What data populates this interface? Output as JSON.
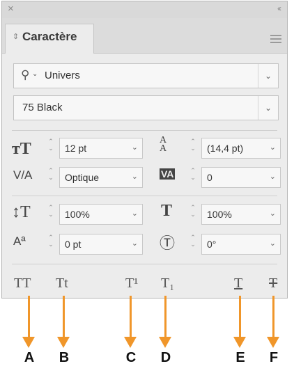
{
  "panel": {
    "close_glyph": "×",
    "collapse_glyph": "‹‹",
    "tab_arrows": "⇕",
    "tab_label": "Caractère"
  },
  "font": {
    "family": "Univers",
    "style": "75 Black"
  },
  "controls": {
    "size": "12 pt",
    "leading": "(14,4 pt)",
    "kerning": "Optique",
    "tracking": "0",
    "vertical_scale": "100%",
    "horizontal_scale": "100%",
    "baseline_shift": "0 pt",
    "rotation": "0°"
  },
  "type_buttons": [
    {
      "glyph": "TT",
      "name": "all-caps"
    },
    {
      "glyph": "Tt",
      "name": "small-caps"
    },
    {
      "glyph": "T¹",
      "name": "superscript"
    },
    {
      "glyph": "T₁",
      "name": "subscript"
    },
    {
      "glyph": "T",
      "name": "underline"
    },
    {
      "glyph": "T",
      "name": "strikethrough"
    }
  ],
  "callouts": [
    "A",
    "B",
    "C",
    "D",
    "E",
    "F"
  ],
  "colors": {
    "arrow": "#f0962a"
  }
}
